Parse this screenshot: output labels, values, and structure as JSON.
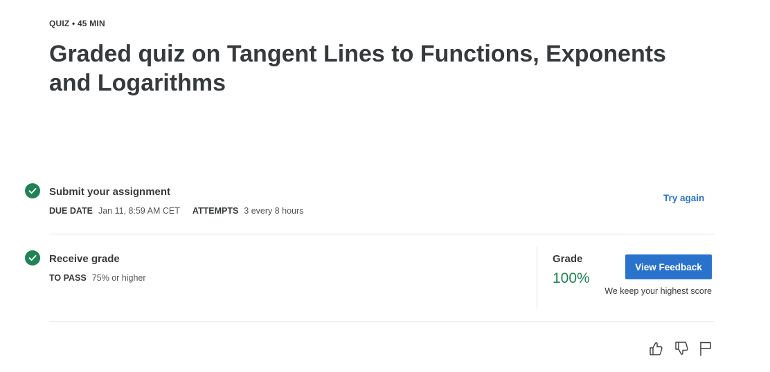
{
  "header": {
    "eyebrow": "QUIZ • 45 MIN",
    "title": "Graded quiz on Tangent Lines to Functions, Exponents and Logarithms"
  },
  "submit_step": {
    "title": "Submit your assignment",
    "due_date_label": "DUE DATE",
    "due_date_value": "Jan 11, 8:59 AM CET",
    "attempts_label": "ATTEMPTS",
    "attempts_value": "3 every 8 hours",
    "try_again_label": "Try again"
  },
  "grade_step": {
    "title": "Receive grade",
    "to_pass_label": "TO PASS",
    "to_pass_value": "75% or higher",
    "grade_label": "Grade",
    "grade_value": "100%",
    "view_feedback_label": "View Feedback",
    "note": "We keep your highest score"
  },
  "colors": {
    "accent": "#2a73cc",
    "success": "#1f8354",
    "text": "#373a3c"
  },
  "footer_icons": [
    "thumbs-up-icon",
    "thumbs-down-icon",
    "flag-icon"
  ]
}
